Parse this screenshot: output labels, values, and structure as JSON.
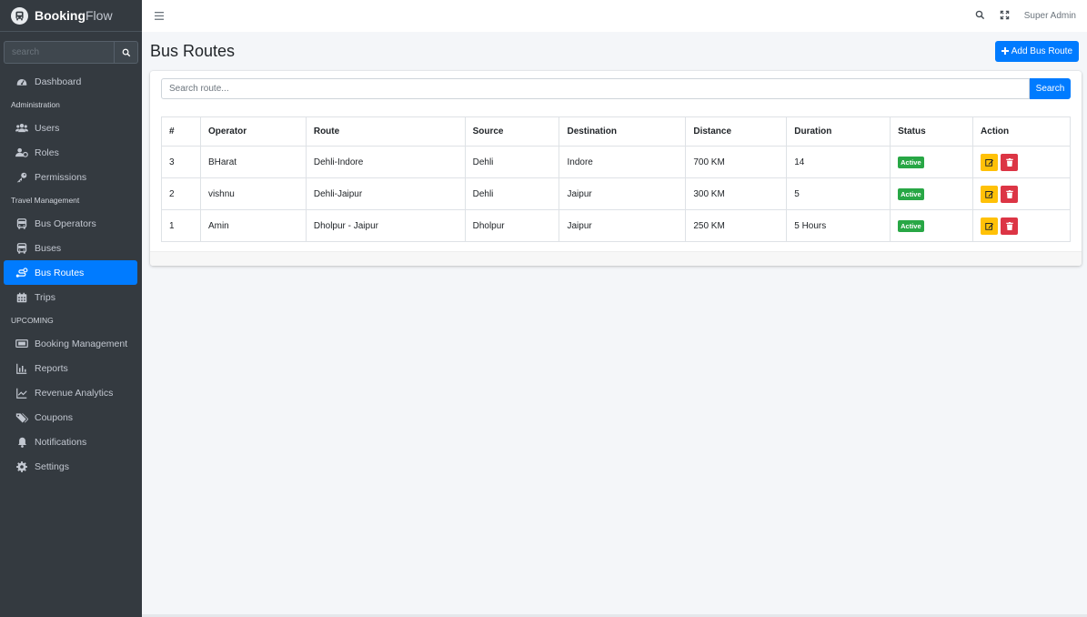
{
  "brand": {
    "bold": "Booking",
    "light": "Flow"
  },
  "sidebar": {
    "search_placeholder": "search",
    "items": [
      {
        "type": "item",
        "label": "Dashboard",
        "icon": "dashboard-icon"
      },
      {
        "type": "header",
        "label": "Administration"
      },
      {
        "type": "item",
        "label": "Users",
        "icon": "users-icon"
      },
      {
        "type": "item",
        "label": "Roles",
        "icon": "roles-icon"
      },
      {
        "type": "item",
        "label": "Permissions",
        "icon": "key-icon"
      },
      {
        "type": "header",
        "label": "Travel Management"
      },
      {
        "type": "item",
        "label": "Bus Operators",
        "icon": "bus-icon"
      },
      {
        "type": "item",
        "label": "Buses",
        "icon": "bus-icon"
      },
      {
        "type": "item",
        "label": "Bus Routes",
        "icon": "route-icon",
        "active": true
      },
      {
        "type": "item",
        "label": "Trips",
        "icon": "calendar-icon"
      },
      {
        "type": "header",
        "label": "UPCOMING"
      },
      {
        "type": "item",
        "label": "Booking Management",
        "icon": "ticket-icon"
      },
      {
        "type": "item",
        "label": "Reports",
        "icon": "chart-icon"
      },
      {
        "type": "item",
        "label": "Revenue Analytics",
        "icon": "trend-icon"
      },
      {
        "type": "item",
        "label": "Coupons",
        "icon": "tags-icon"
      },
      {
        "type": "item",
        "label": "Notifications",
        "icon": "bell-icon"
      },
      {
        "type": "item",
        "label": "Settings",
        "icon": "gear-icon"
      }
    ]
  },
  "topbar": {
    "user": "Super Admin"
  },
  "page": {
    "title": "Bus Routes",
    "add_button": "Add Bus Route",
    "search_placeholder": "Search route...",
    "search_button": "Search"
  },
  "table": {
    "columns": [
      "#",
      "Operator",
      "Route",
      "Source",
      "Destination",
      "Distance",
      "Duration",
      "Status",
      "Action"
    ],
    "rows": [
      {
        "id": "3",
        "operator": "BHarat",
        "route": "Dehli-Indore",
        "source": "Dehli",
        "destination": "Indore",
        "distance": "700 KM",
        "duration": "14",
        "status": "Active"
      },
      {
        "id": "2",
        "operator": "vishnu",
        "route": "Dehli-Jaipur",
        "source": "Dehli",
        "destination": "Jaipur",
        "distance": "300 KM",
        "duration": "5",
        "status": "Active"
      },
      {
        "id": "1",
        "operator": "Amin",
        "route": "Dholpur - Jaipur",
        "source": "Dholpur",
        "destination": "Jaipur",
        "distance": "250 KM",
        "duration": "5 Hours",
        "status": "Active"
      }
    ]
  },
  "colors": {
    "primary": "#007bff",
    "sidebar": "#343a40",
    "success": "#28a745",
    "warning": "#ffc107",
    "danger": "#dc3545"
  }
}
